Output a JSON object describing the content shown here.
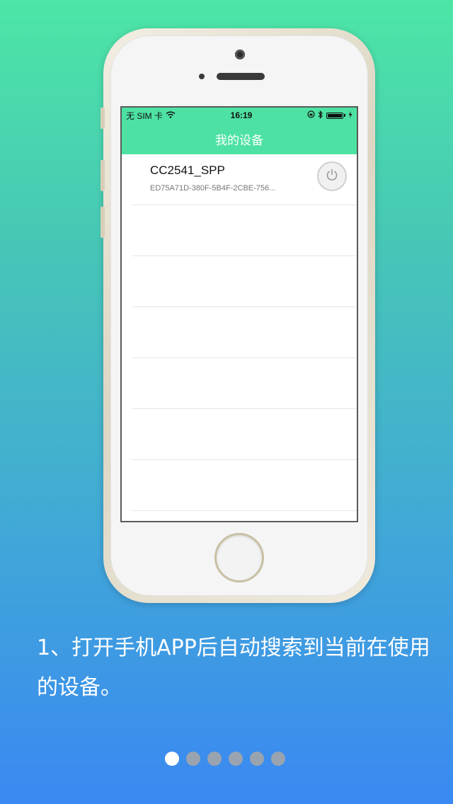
{
  "status_bar": {
    "carrier": "无 SIM 卡",
    "time": "16:19"
  },
  "nav": {
    "title": "我的设备"
  },
  "devices": [
    {
      "name": "CC2541_SPP",
      "id": "ED75A71D-380F-5B4F-2CBE-756..."
    }
  ],
  "caption": "1、打开手机APP后自动搜索到当前在使用的设备。",
  "pagination": {
    "total": 6,
    "active": 1
  },
  "colors": {
    "accent": "#4de2a3",
    "background_top": "#4de6a6",
    "background_bottom": "#3a88f2"
  },
  "icons": {
    "power": "power-icon",
    "wifi": "wifi-icon",
    "bluetooth": "bluetooth-icon",
    "battery": "battery-icon",
    "lock_rotation": "rotation-lock-icon"
  }
}
